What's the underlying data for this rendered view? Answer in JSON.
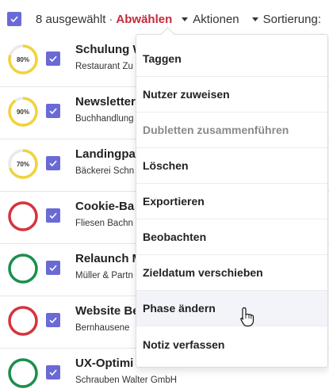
{
  "toolbar": {
    "selected_count": "8 ausgewählt",
    "separator": "·",
    "deselect_label": "Abwählen",
    "actions_label": "Aktionen",
    "sort_label": "Sortierung:"
  },
  "rows": [
    {
      "title": "Schulung W",
      "subtitle": "Restaurant Zu",
      "progress_label": "80%",
      "progress": 0.8,
      "ring_color": "#f2d23a"
    },
    {
      "title": "Newsletter",
      "subtitle": "Buchhandlung",
      "progress_label": "90%",
      "progress": 0.9,
      "ring_color": "#f2d23a"
    },
    {
      "title": "Landingpa",
      "subtitle": "Bäckerei Schn",
      "progress_label": "70%",
      "progress": 0.7,
      "ring_color": "#f2d23a"
    },
    {
      "title": "Cookie-Ba",
      "subtitle": "Fliesen Bachn",
      "progress_label": "",
      "progress": 1.0,
      "ring_color": "#d6333f"
    },
    {
      "title": "Relaunch M",
      "subtitle": "Müller & Partn",
      "progress_label": "",
      "progress": 1.0,
      "ring_color": "#1a8f4c"
    },
    {
      "title": "Website Be",
      "subtitle": "Bernhausene",
      "progress_label": "",
      "progress": 1.0,
      "ring_color": "#d6333f"
    },
    {
      "title": "UX-Optimi",
      "subtitle": "Schrauben Walter GmbH",
      "progress_label": "",
      "progress": 1.0,
      "ring_color": "#1a8f4c"
    }
  ],
  "menu": {
    "items": [
      {
        "label": "Taggen",
        "disabled": false
      },
      {
        "label": "Nutzer zuweisen",
        "disabled": false
      },
      {
        "label": "Dubletten zusammenführen",
        "disabled": true
      },
      {
        "label": "Löschen",
        "disabled": false
      },
      {
        "label": "Exportieren",
        "disabled": false
      },
      {
        "label": "Beobachten",
        "disabled": false
      },
      {
        "label": "Zieldatum verschieben",
        "disabled": false
      },
      {
        "label": "Phase ändern",
        "disabled": false,
        "hovered": true
      },
      {
        "label": "Notiz verfassen",
        "disabled": false
      }
    ]
  },
  "colors": {
    "accent": "#6a6ad6",
    "deselect": "#c8283c",
    "ring_track": "#e9e9e9"
  },
  "icons": {
    "checkbox": "check-icon",
    "cursor": "hand-pointer-icon"
  }
}
